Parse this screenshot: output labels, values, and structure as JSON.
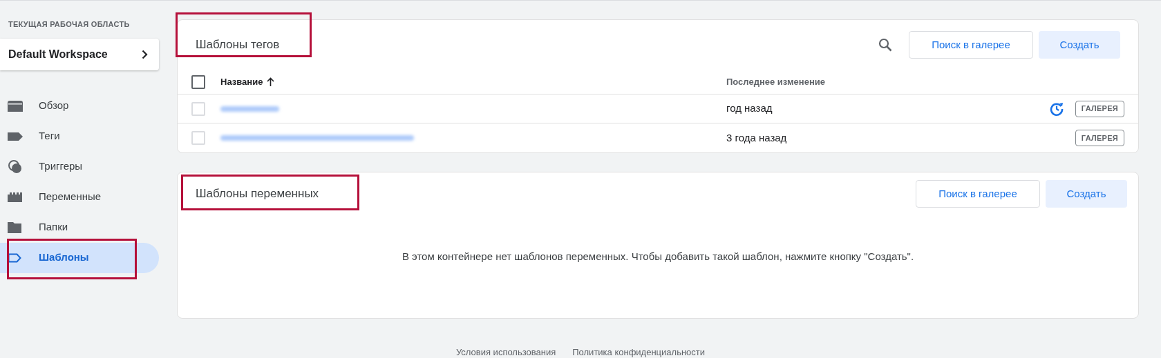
{
  "sidebar": {
    "workspace_label": "ТЕКУЩАЯ РАБОЧАЯ ОБЛАСТЬ",
    "workspace": "Default Workspace",
    "items": [
      {
        "label": "Обзор",
        "kind": "overview",
        "selected": false,
        "highlighted": false
      },
      {
        "label": "Теги",
        "kind": "tag",
        "selected": false,
        "highlighted": false
      },
      {
        "label": "Триггеры",
        "kind": "trigger",
        "selected": false,
        "highlighted": false
      },
      {
        "label": "Переменные",
        "kind": "variable",
        "selected": false,
        "highlighted": false
      },
      {
        "label": "Папки",
        "kind": "folder",
        "selected": false,
        "highlighted": false
      },
      {
        "label": "Шаблоны",
        "kind": "template",
        "selected": true,
        "highlighted": true
      }
    ]
  },
  "tag_templates": {
    "title": "Шаблоны тегов",
    "highlighted": true,
    "gallery_button": "Поиск в галерее",
    "create_button": "Создать",
    "columns": [
      "Название",
      "Последнее изменение"
    ],
    "header_checked": false,
    "rows": [
      {
        "checked": false,
        "modified": "год назад",
        "update_available": true,
        "source": "ГАЛЕРЕЯ"
      },
      {
        "checked": false,
        "modified": "3 года назад",
        "update_available": false,
        "source": "ГАЛЕРЕЯ"
      }
    ]
  },
  "variable_templates": {
    "title": "Шаблоны переменных",
    "highlighted": true,
    "gallery_button": "Поиск в галерее",
    "create_button": "Создать",
    "empty_message": "В этом контейнере нет шаблонов переменных. Чтобы добавить такой шаблон, нажмите кнопку \"Создать\"."
  },
  "footer": [
    "Условия использования",
    "Политика конфиденциальности"
  ]
}
